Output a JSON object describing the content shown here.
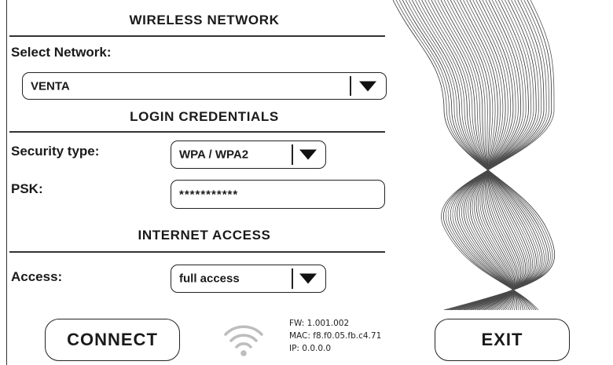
{
  "wireless": {
    "heading": "WIRELESS NETWORK",
    "select_label": "Select Network:",
    "network_value": "VENTA"
  },
  "credentials": {
    "heading": "LOGIN CREDENTIALS",
    "security_label": "Security type:",
    "security_value": "WPA / WPA2",
    "psk_label": "PSK:",
    "psk_value": "***********"
  },
  "internet": {
    "heading": "INTERNET ACCESS",
    "access_label": "Access:",
    "access_value": "full access"
  },
  "footer": {
    "connect_label": "CONNECT",
    "exit_label": "EXIT",
    "fw": "FW: 1.001.002",
    "mac": "MAC: f8.f0.05.fb.c4.71",
    "ip": "IP:  0.0.0.0"
  },
  "icons": {
    "dropdown": "caret-down-icon",
    "wifi": "wifi-icon",
    "decoration": "wave-lines-graphic"
  },
  "colors": {
    "ink": "#1a1a1a",
    "wifi_gray": "#bdbdbd",
    "background": "#ffffff"
  }
}
